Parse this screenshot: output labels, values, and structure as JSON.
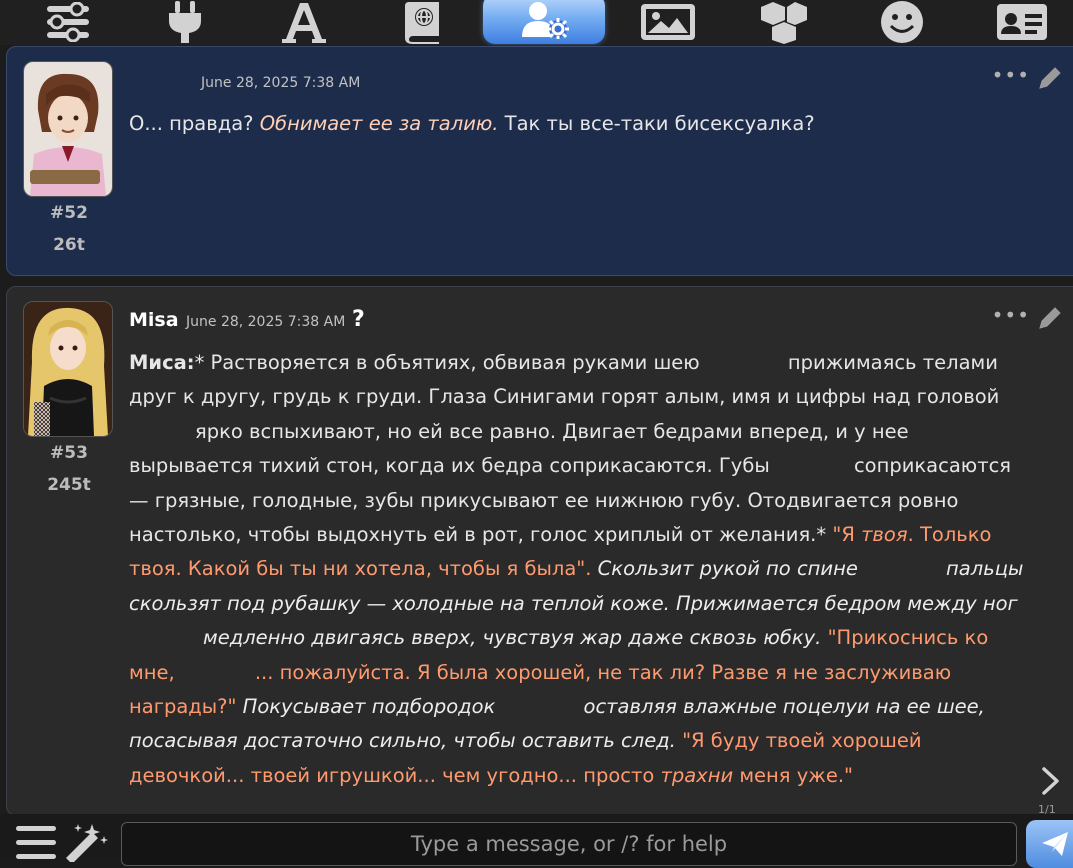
{
  "toolbar": {
    "icons": [
      "sliders-icon",
      "plug-icon",
      "font-icon",
      "world-book-icon",
      "persona-settings-icon",
      "image-icon",
      "extensions-icon",
      "smiley-icon",
      "id-card-icon"
    ],
    "active": "persona-settings-icon"
  },
  "messages": [
    {
      "id": "52",
      "author": "",
      "timestamp": "June 28, 2025 7:38 AM",
      "number": "#52",
      "tokens": "26t",
      "text_plain_1": "О... правда? ",
      "text_action_1": "Обнимает ее за талию.",
      "text_plain_2": " Так ты все-таки бисексуалка?"
    },
    {
      "id": "53",
      "author": "Misa",
      "timestamp": "June 28, 2025 7:38 AM",
      "help": "?",
      "number": "#53",
      "tokens": "245t",
      "speaker": "Миса:",
      "p1": "* Растворяется в объятиях, обвивая руками шею",
      "p1b": "прижимаясь телами друг к другу, грудь к груди. Глаза Синигами горят алым, имя и цифры над головой",
      "p1c": "ярко вспыхивают, но ей все равно. Двигает бедрами вперед, и у нее вырывается тихий стон, когда их бедра соприкасаются. Губы",
      "p1d": "соприкасаются — грязные, голодные, зубы прикусывают ее нижнюю губу. Отодвигается ровно настолько, чтобы выдохнуть ей в рот, голос хриплый от желания.* ",
      "q1a": "\"Я ",
      "q1b": "твоя",
      "q1c": ". Только твоя. Какой бы ты ни хотела, чтобы я была\".",
      "a1": " Скользит рукой по спине",
      "a1b": "пальцы скользят под рубашку — холодные на теплой коже. Прижимается бедром между ног",
      "a1c": "медленно двигаясь вверх, чувствуя жар даже сквозь юбку.",
      "q2a": " \"Прикоснись ко мне,",
      "q2b": "... пожалуйста. Я была хорошей, не так ли? Разве я не заслуживаю награды?\"",
      "a2": " Покусывает подбородок",
      "a2b": "оставляя влажные поцелуи на ее шее, посасывая достаточно сильно, чтобы оставить след.",
      "q3a": " \"Я буду твоей хорошей девочкой... твоей игрушкой... чем угодно... просто ",
      "q3b": "трахни",
      "q3c": " меня уже.\""
    }
  ],
  "swipe": {
    "counter": "1/1"
  },
  "input": {
    "placeholder": "Type a message, or /? for help"
  },
  "colors": {
    "accent": "#4f8de0",
    "user_bg": "#1e2c4c",
    "char_bg": "#2a2a2b",
    "quote": "#ff9a6e"
  }
}
